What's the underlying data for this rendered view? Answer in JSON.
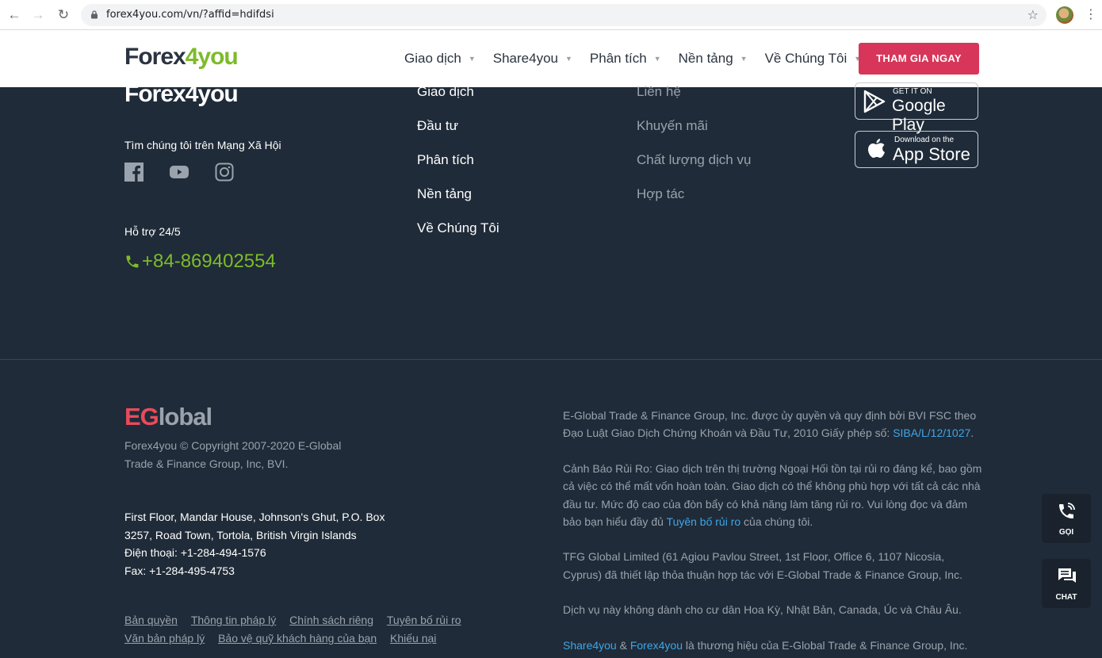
{
  "browser": {
    "url": "forex4you.com/vn/?affid=hdifdsi"
  },
  "header": {
    "logo": {
      "forex": "Forex",
      "num": "4",
      "you": "you"
    },
    "nav": [
      {
        "label": "Giao dịch"
      },
      {
        "label": "Share4you"
      },
      {
        "label": "Phân tích"
      },
      {
        "label": "Nền tảng"
      },
      {
        "label": "Về Chúng Tôi"
      }
    ],
    "cta": "THAM GIA NGAY"
  },
  "footer": {
    "logo": {
      "forex": "Forex",
      "num": "4",
      "you": "you"
    },
    "social_heading": "Tìm chúng tôi trên Mạng Xã Hội",
    "social_icons": [
      "facebook-icon",
      "youtube-icon",
      "instagram-icon"
    ],
    "support_label": "Hỗ trợ 24/5",
    "phone": "+84-869402554",
    "col1": [
      "Giao dịch",
      "Đầu tư",
      "Phân tích",
      "Nền tảng",
      "Về Chúng Tôi"
    ],
    "col2": [
      "Liên hệ",
      "Khuyến mãi",
      "Chất lượng dịch vụ",
      "Hợp tác"
    ],
    "google_play": {
      "small": "GET IT ON",
      "big": "Google Play"
    },
    "app_store": {
      "small": "Download on the",
      "big": "App Store"
    }
  },
  "bottom": {
    "eglobal": {
      "eg": "EG",
      "rest": "lobal"
    },
    "copyright": "Forex4you © Copyright 2007-2020 E-Global Trade & Finance Group, Inc, BVI.",
    "address_lines": [
      "First Floor, Mandar House, Johnson's Ghut, P.O. Box",
      "3257, Road Town, Tortola, British Virgin Islands",
      "Điện thoại: +1-284-494-1576",
      "Fax: +1-284-495-4753"
    ],
    "legal_links": [
      "Bản quyền",
      "Thông tin pháp lý",
      "Chính sách riêng",
      "Tuyên bố rủi ro",
      "Văn bản pháp lý",
      "Bảo vệ quỹ khách hàng của bạn",
      "Khiếu nại"
    ],
    "para1_pre": "E-Global Trade & Finance Group, Inc. được ủy quyền và quy định bởi BVI FSC theo Đạo Luật Giao Dịch Chứng Khoán và Đầu Tư, 2010 Giấy phép số: ",
    "para1_link": "SIBA/L/12/1027",
    "para1_post": ".",
    "para2_pre": "Cảnh Báo Rủi Ro: Giao dịch trên thị trường Ngoại Hối tồn tại rủi ro đáng kể, bao gồm cả việc có thể mất vốn hoàn toàn. Giao dịch có thể không phù hợp với tất cả các nhà đầu tư. Mức độ cao của đòn bẩy có khả năng làm tăng rủi ro. Vui lòng đọc và đảm bảo bạn hiểu đầy đủ ",
    "para2_link": "Tuyên bố rủi ro",
    "para2_post": " của chúng tôi.",
    "para3": "TFG Global Limited (61 Agiou Pavlou Street, 1st Floor, Office 6, 1107 Nicosia, Cyprus) đã thiết lập thỏa thuận hợp tác với E-Global Trade & Finance Group, Inc.",
    "para4": "Dịch vụ này không dành cho cư dân Hoa Kỳ, Nhật Bản, Canada, Úc và Châu Âu.",
    "para5_link1": "Share4you",
    "para5_amp": " & ",
    "para5_link2": "Forex4you",
    "para5_post": " là thương hiệu của E-Global Trade & Finance Group, Inc."
  },
  "floating": {
    "call_label": "GỌI",
    "chat_label": "CHAT"
  }
}
